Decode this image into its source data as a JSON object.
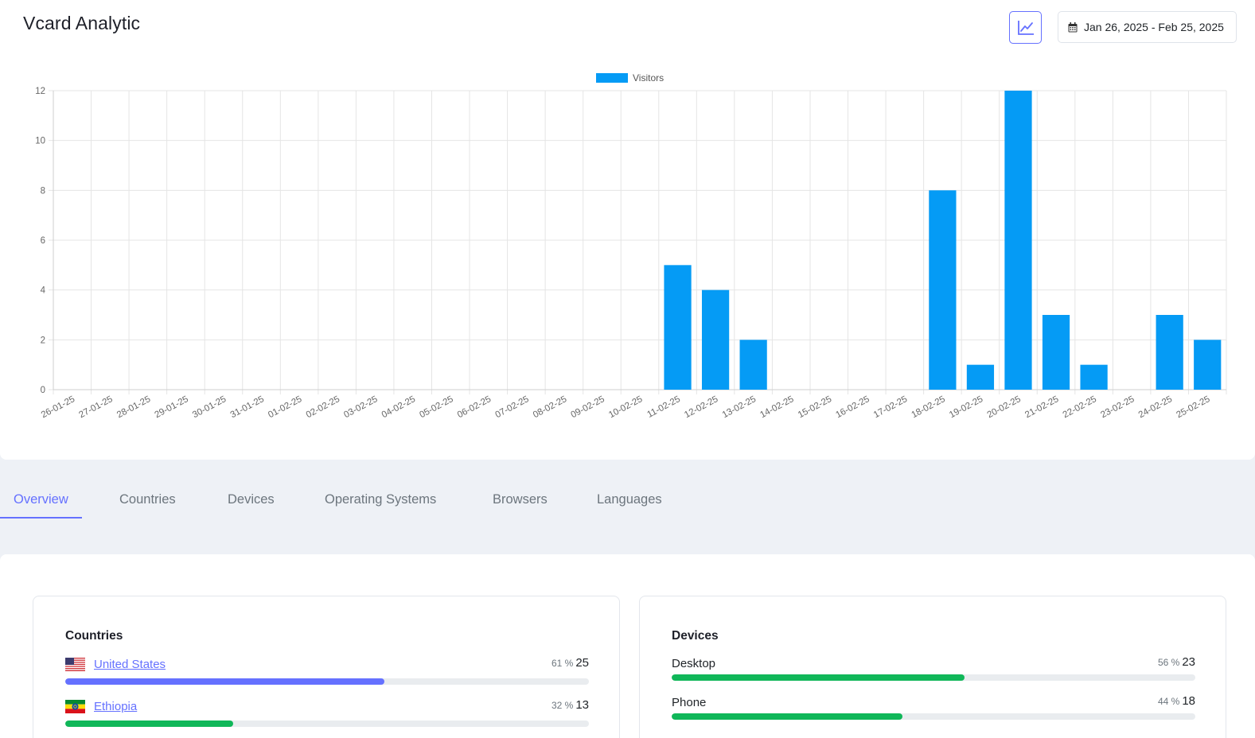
{
  "header": {
    "title": "Vcard Analytic",
    "date_range": "Jan 26, 2025 - Feb 25, 2025",
    "chart_button_icon": "line-chart-icon",
    "calendar_icon": "calendar-icon"
  },
  "chart_data": {
    "type": "bar",
    "legend": [
      "Visitors"
    ],
    "legend_position": "top-center",
    "grid": true,
    "ylim": [
      0,
      12
    ],
    "yticks": [
      0,
      2,
      4,
      6,
      8,
      10,
      12
    ],
    "categories": [
      "26-01-25",
      "27-01-25",
      "28-01-25",
      "29-01-25",
      "30-01-25",
      "31-01-25",
      "01-02-25",
      "02-02-25",
      "03-02-25",
      "04-02-25",
      "05-02-25",
      "06-02-25",
      "07-02-25",
      "08-02-25",
      "09-02-25",
      "10-02-25",
      "11-02-25",
      "12-02-25",
      "13-02-25",
      "14-02-25",
      "15-02-25",
      "16-02-25",
      "17-02-25",
      "18-02-25",
      "19-02-25",
      "20-02-25",
      "21-02-25",
      "22-02-25",
      "23-02-25",
      "24-02-25",
      "25-02-25"
    ],
    "series": [
      {
        "name": "Visitors",
        "color": "#059bf5",
        "values": [
          0,
          0,
          0,
          0,
          0,
          0,
          0,
          0,
          0,
          0,
          0,
          0,
          0,
          0,
          0,
          0,
          5,
          4,
          2,
          0,
          0,
          0,
          0,
          8,
          1,
          12,
          3,
          1,
          0,
          3,
          2
        ]
      }
    ]
  },
  "tabs": [
    {
      "label": "Overview",
      "active": true
    },
    {
      "label": "Countries",
      "active": false
    },
    {
      "label": "Devices",
      "active": false
    },
    {
      "label": "Operating Systems",
      "active": false
    },
    {
      "label": "Browsers",
      "active": false
    },
    {
      "label": "Languages",
      "active": false
    }
  ],
  "countries": {
    "title": "Countries",
    "items": [
      {
        "name": "United States",
        "flag_icon": "us-flag-icon",
        "percent_label": "61 %",
        "count": "25",
        "fraction": 0.61,
        "color": "#6571ff"
      },
      {
        "name": "Ethiopia",
        "flag_icon": "ethiopia-flag-icon",
        "percent_label": "32 %",
        "count": "13",
        "fraction": 0.32,
        "color": "#10b759"
      }
    ]
  },
  "devices": {
    "title": "Devices",
    "items": [
      {
        "name": "Desktop",
        "percent_label": "56 %",
        "count": "23",
        "fraction": 0.56,
        "color": "#10b759"
      },
      {
        "name": "Phone",
        "percent_label": "44 %",
        "count": "18",
        "fraction": 0.44,
        "color": "#10b759"
      }
    ]
  }
}
